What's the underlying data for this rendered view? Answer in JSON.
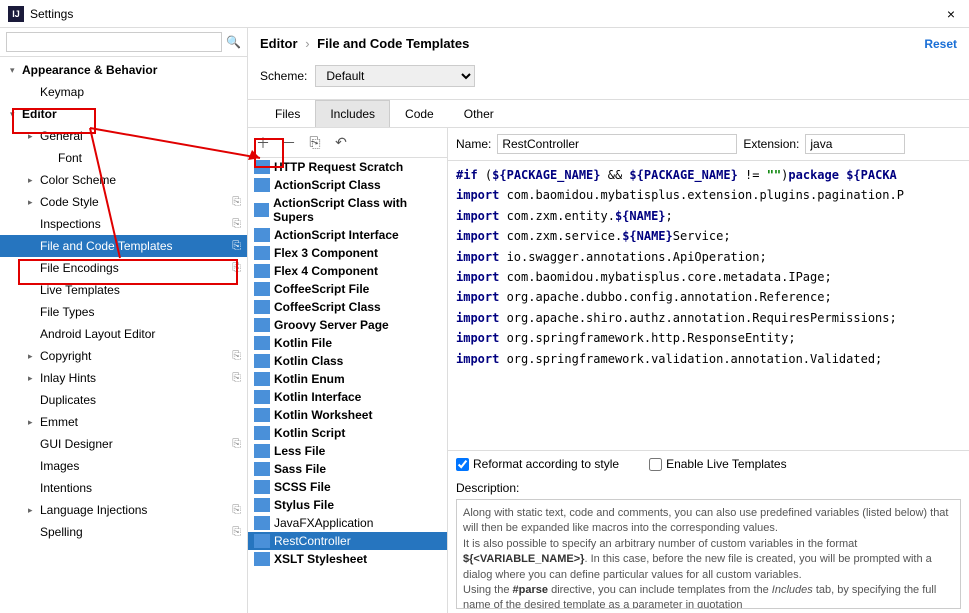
{
  "titlebar": {
    "title": "Settings",
    "close": "×"
  },
  "sidebar": {
    "search_placeholder": "",
    "items": [
      {
        "label": "Appearance & Behavior",
        "depth": 0,
        "caret": "▾",
        "bold": true,
        "copy": false
      },
      {
        "label": "Keymap",
        "depth": 1,
        "caret": "",
        "bold": false,
        "copy": false
      },
      {
        "label": "Editor",
        "depth": 0,
        "caret": "▾",
        "bold": true,
        "copy": false,
        "redbox": true
      },
      {
        "label": "General",
        "depth": 1,
        "caret": "▸",
        "bold": false,
        "copy": false
      },
      {
        "label": "Font",
        "depth": 2,
        "caret": "",
        "bold": false,
        "copy": false
      },
      {
        "label": "Color Scheme",
        "depth": 1,
        "caret": "▸",
        "bold": false,
        "copy": false
      },
      {
        "label": "Code Style",
        "depth": 1,
        "caret": "▸",
        "bold": false,
        "copy": true
      },
      {
        "label": "Inspections",
        "depth": 1,
        "caret": "",
        "bold": false,
        "copy": true
      },
      {
        "label": "File and Code Templates",
        "depth": 1,
        "caret": "",
        "bold": false,
        "copy": true,
        "selected": true,
        "redbox": true
      },
      {
        "label": "File Encodings",
        "depth": 1,
        "caret": "",
        "bold": false,
        "copy": true
      },
      {
        "label": "Live Templates",
        "depth": 1,
        "caret": "",
        "bold": false,
        "copy": false
      },
      {
        "label": "File Types",
        "depth": 1,
        "caret": "",
        "bold": false,
        "copy": false
      },
      {
        "label": "Android Layout Editor",
        "depth": 1,
        "caret": "",
        "bold": false,
        "copy": false
      },
      {
        "label": "Copyright",
        "depth": 1,
        "caret": "▸",
        "bold": false,
        "copy": true
      },
      {
        "label": "Inlay Hints",
        "depth": 1,
        "caret": "▸",
        "bold": false,
        "copy": true
      },
      {
        "label": "Duplicates",
        "depth": 1,
        "caret": "",
        "bold": false,
        "copy": false
      },
      {
        "label": "Emmet",
        "depth": 1,
        "caret": "▸",
        "bold": false,
        "copy": false
      },
      {
        "label": "GUI Designer",
        "depth": 1,
        "caret": "",
        "bold": false,
        "copy": true
      },
      {
        "label": "Images",
        "depth": 1,
        "caret": "",
        "bold": false,
        "copy": false
      },
      {
        "label": "Intentions",
        "depth": 1,
        "caret": "",
        "bold": false,
        "copy": false
      },
      {
        "label": "Language Injections",
        "depth": 1,
        "caret": "▸",
        "bold": false,
        "copy": true
      },
      {
        "label": "Spelling",
        "depth": 1,
        "caret": "",
        "bold": false,
        "copy": true
      }
    ]
  },
  "breadcrumb": {
    "a": "Editor",
    "sep": "›",
    "b": "File and Code Templates"
  },
  "reset_label": "Reset",
  "scheme": {
    "label": "Scheme:",
    "value": "Default"
  },
  "tabs": [
    {
      "label": "Files",
      "active": false
    },
    {
      "label": "Includes",
      "active": true
    },
    {
      "label": "Code",
      "active": false
    },
    {
      "label": "Other",
      "active": false
    }
  ],
  "toolbar": {
    "add": "＋",
    "remove": "－",
    "copy": "⎘",
    "undo": "↶"
  },
  "templates": [
    {
      "label": "HTTP Request Scratch",
      "bold": true
    },
    {
      "label": "ActionScript Class",
      "bold": true
    },
    {
      "label": "ActionScript Class with Supers",
      "bold": true
    },
    {
      "label": "ActionScript Interface",
      "bold": true
    },
    {
      "label": "Flex 3 Component",
      "bold": true
    },
    {
      "label": "Flex 4 Component",
      "bold": true
    },
    {
      "label": "CoffeeScript File",
      "bold": true
    },
    {
      "label": "CoffeeScript Class",
      "bold": true
    },
    {
      "label": "Groovy Server Page",
      "bold": true
    },
    {
      "label": "Kotlin File",
      "bold": true
    },
    {
      "label": "Kotlin Class",
      "bold": true
    },
    {
      "label": "Kotlin Enum",
      "bold": true
    },
    {
      "label": "Kotlin Interface",
      "bold": true
    },
    {
      "label": "Kotlin Worksheet",
      "bold": true
    },
    {
      "label": "Kotlin Script",
      "bold": true
    },
    {
      "label": "Less File",
      "bold": true
    },
    {
      "label": "Sass File",
      "bold": true
    },
    {
      "label": "SCSS File",
      "bold": true
    },
    {
      "label": "Stylus File",
      "bold": true
    },
    {
      "label": "JavaFXApplication",
      "bold": false
    },
    {
      "label": "RestController",
      "bold": false,
      "selected": true
    },
    {
      "label": "XSLT Stylesheet",
      "bold": true
    }
  ],
  "name_row": {
    "name_label": "Name:",
    "name_value": "RestController",
    "ext_label": "Extension:",
    "ext_value": "java"
  },
  "code_lines": [
    {
      "parts": [
        {
          "t": "#if",
          "c": "kw"
        },
        {
          "t": " (",
          "c": "sym"
        },
        {
          "t": "${PACKAGE_NAME}",
          "c": "var"
        },
        {
          "t": " && ",
          "c": "sym"
        },
        {
          "t": "${PACKAGE_NAME}",
          "c": "var"
        },
        {
          "t": " != ",
          "c": "sym"
        },
        {
          "t": "\"\"",
          "c": "str"
        },
        {
          "t": ")",
          "c": "sym"
        },
        {
          "t": "package",
          "c": "kw"
        },
        {
          "t": " ",
          "c": "sym"
        },
        {
          "t": "${PACKA",
          "c": "var"
        }
      ]
    },
    {
      "parts": [
        {
          "t": "",
          "c": "sym"
        }
      ]
    },
    {
      "parts": [
        {
          "t": "import",
          "c": "kw"
        },
        {
          "t": " com.baomidou.mybatisplus.extension.plugins.pagination.P",
          "c": "sym"
        }
      ]
    },
    {
      "parts": [
        {
          "t": "import",
          "c": "kw"
        },
        {
          "t": " com.zxm.entity.",
          "c": "sym"
        },
        {
          "t": "${NAME}",
          "c": "var"
        },
        {
          "t": ";",
          "c": "sym"
        }
      ]
    },
    {
      "parts": [
        {
          "t": "import",
          "c": "kw"
        },
        {
          "t": " com.zxm.service.",
          "c": "sym"
        },
        {
          "t": "${NAME}",
          "c": "var"
        },
        {
          "t": "Service;",
          "c": "sym"
        }
      ]
    },
    {
      "parts": [
        {
          "t": "",
          "c": "sym"
        }
      ]
    },
    {
      "parts": [
        {
          "t": "import",
          "c": "kw"
        },
        {
          "t": " io.swagger.annotations.ApiOperation;",
          "c": "sym"
        }
      ]
    },
    {
      "parts": [
        {
          "t": "import",
          "c": "kw"
        },
        {
          "t": " com.baomidou.mybatisplus.core.metadata.IPage;",
          "c": "sym"
        }
      ]
    },
    {
      "parts": [
        {
          "t": "import",
          "c": "kw"
        },
        {
          "t": " org.apache.dubbo.config.annotation.Reference;",
          "c": "sym"
        }
      ]
    },
    {
      "parts": [
        {
          "t": "import",
          "c": "kw"
        },
        {
          "t": " org.apache.shiro.authz.annotation.RequiresPermissions;",
          "c": "sym"
        }
      ]
    },
    {
      "parts": [
        {
          "t": "import",
          "c": "kw"
        },
        {
          "t": " org.springframework.http.ResponseEntity;",
          "c": "sym"
        }
      ]
    },
    {
      "parts": [
        {
          "t": "import",
          "c": "kw"
        },
        {
          "t": " org.springframework.validation.annotation.Validated;",
          "c": "sym"
        }
      ]
    }
  ],
  "checks": {
    "reformat": "Reformat according to style",
    "live": "Enable Live Templates",
    "reformat_checked": true,
    "live_checked": false
  },
  "desc": {
    "label": "Description:",
    "p1": "Along with static text, code and comments, you can also use predefined variables (listed below) that will then be expanded like macros into the corresponding values.",
    "p2a": "It is also possible to specify an arbitrary number of custom variables in the format ",
    "p2b": "${<VARIABLE_NAME>}",
    "p2c": ". In this case, before the new file is created, you will be prompted with a dialog where you can define particular values for all custom variables.",
    "p3a": "Using the ",
    "p3b": "#parse",
    "p3c": " directive, you can include templates from the ",
    "p3d": "Includes",
    "p3e": " tab, by specifying the full name of the desired template as a parameter in quotation"
  }
}
